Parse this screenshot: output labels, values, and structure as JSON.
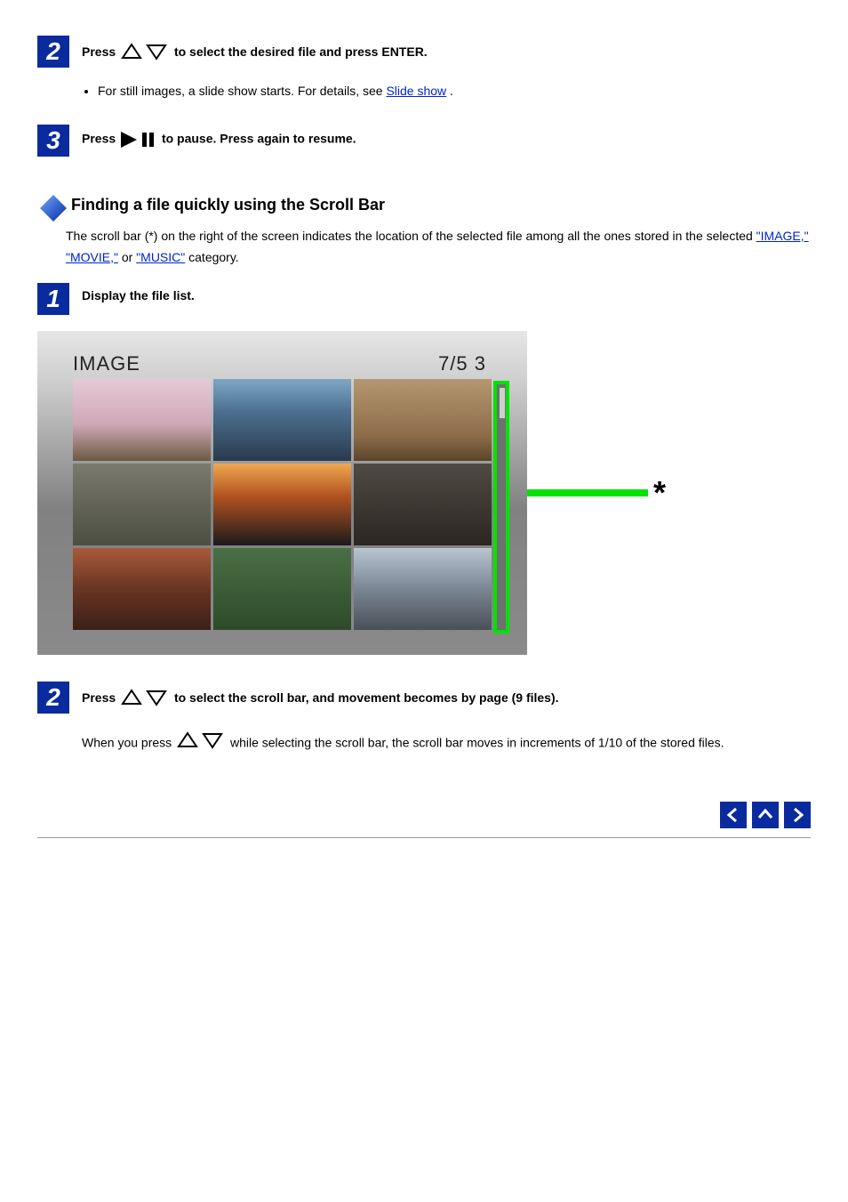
{
  "step2": {
    "number": "2",
    "before_icon": "Press ",
    "after_icon": " to select the desired file and press ENTER.",
    "bullet_before_link": "For still images, a slide show starts. For details, see ",
    "bullet_link": "Slide show",
    "bullet_after_link": "."
  },
  "step3": {
    "number": "3",
    "before_icon": "Press ",
    "after_icon": " to pause. Press again to resume."
  },
  "section": {
    "title": "Finding a file quickly using the Scroll Bar",
    "para_before_links": "The scroll bar (*) on the right of the screen indicates the location of the selected file among all the ones stored in the selected ",
    "link1": "\"IMAGE,\"",
    "link2": "\"MOVIE,\"",
    "para_between": " or ",
    "link3": "\"MUSIC\"",
    "para_after_links": " category."
  },
  "figure": {
    "title": "IMAGE",
    "counter": "7/5 3",
    "star": "*"
  },
  "step1b": {
    "number": "1",
    "text": "Display the file list."
  },
  "step2b": {
    "number": "2",
    "before_icon": "Press ",
    "after_icon": " to select the scroll bar, and movement becomes by page (9 files).",
    "sub_before_icon": "When you press ",
    "sub_after_icon": " while selecting the scroll bar, the scroll bar moves in increments of 1/10 of the stored files."
  }
}
